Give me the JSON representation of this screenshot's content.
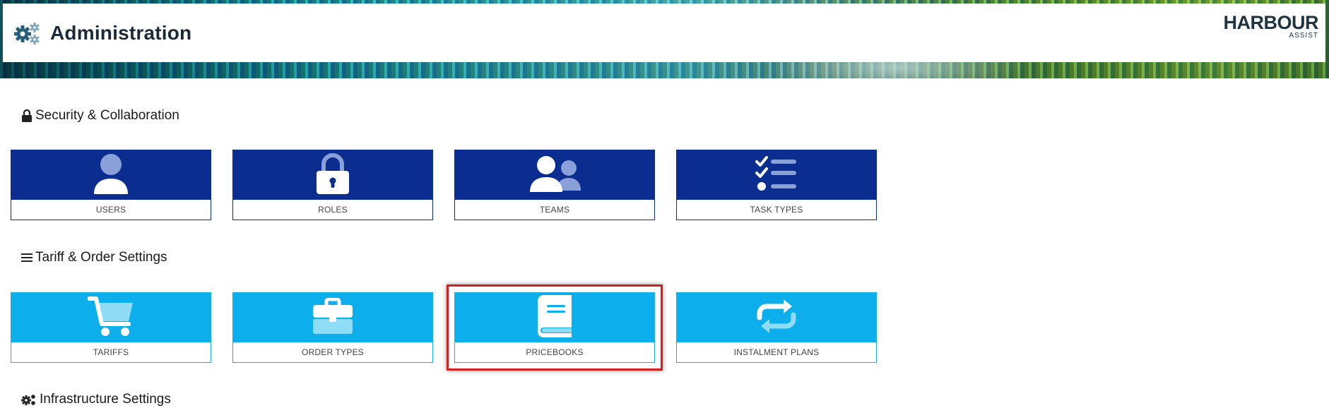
{
  "header": {
    "title": "Administration",
    "gear_icon": "gears-icon",
    "logo": {
      "word": "HARBOUR",
      "sub": "ASSIST"
    }
  },
  "sections": [
    {
      "heading": "Security & Collaboration",
      "icon": "lock-icon",
      "tiles": [
        {
          "label": "USERS",
          "icon": "user-icon"
        },
        {
          "label": "ROLES",
          "icon": "lock-icon"
        },
        {
          "label": "TEAMS",
          "icon": "users-icon"
        },
        {
          "label": "TASK TYPES",
          "icon": "tasks-icon"
        }
      ]
    },
    {
      "heading": "Tariff & Order Settings",
      "icon": "list-icon",
      "tiles": [
        {
          "label": "TARIFFS",
          "icon": "cart-icon"
        },
        {
          "label": "ORDER TYPES",
          "icon": "briefcase-icon"
        },
        {
          "label": "PRICEBOOKS",
          "icon": "book-icon",
          "highlighted": true
        },
        {
          "label": "INSTALMENT PLANS",
          "icon": "repeat-icon"
        }
      ]
    },
    {
      "heading": "Infrastructure Settings",
      "icon": "gears-icon"
    }
  ],
  "colors": {
    "security_tile": "#0a2d8f",
    "tariff_tile": "#0daeec",
    "highlight": "#d42020"
  }
}
